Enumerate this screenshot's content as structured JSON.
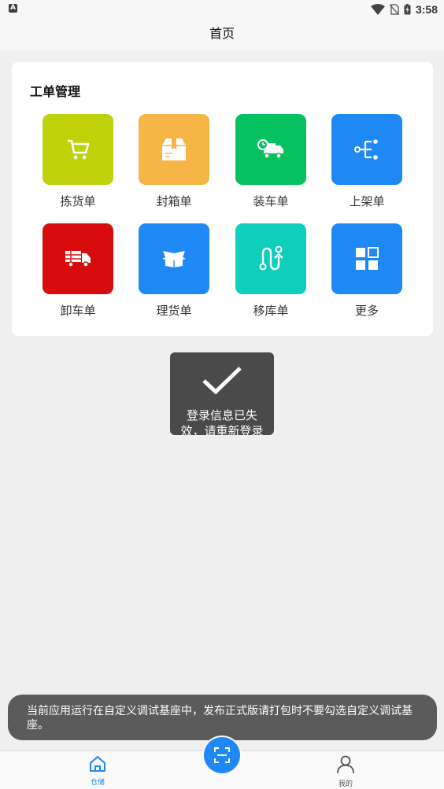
{
  "status_bar": {
    "time": "3:58"
  },
  "header": {
    "title": "首页"
  },
  "work_orders": {
    "title": "工单管理",
    "items": [
      {
        "label": "拣货单",
        "icon": "cart-icon",
        "color": "#bfd20a"
      },
      {
        "label": "封箱单",
        "icon": "box-icon",
        "color": "#f5b547"
      },
      {
        "label": "装车单",
        "icon": "truck-clock-icon",
        "color": "#06c160"
      },
      {
        "label": "上架单",
        "icon": "tree-icon",
        "color": "#1e88f5"
      },
      {
        "label": "卸车单",
        "icon": "unload-truck-icon",
        "color": "#d80c0c"
      },
      {
        "label": "理货单",
        "icon": "open-box-icon",
        "color": "#1e88f5"
      },
      {
        "label": "移库单",
        "icon": "route-icon",
        "color": "#0dcfbc"
      },
      {
        "label": "更多",
        "icon": "grid-icon",
        "color": "#1e88f5"
      }
    ]
  },
  "toast": {
    "message": "登录信息已失效，请重新登录"
  },
  "snackbar": {
    "message": "当前应用运行在自定义调试基座中，发布正式版请打包时不要勾选自定义调试基座。"
  },
  "tabbar": {
    "tabs": [
      {
        "label": "仓储",
        "icon": "home-icon",
        "active": true
      },
      {
        "label": "我的",
        "icon": "person-icon",
        "active": false
      }
    ]
  },
  "colors": {
    "accent": "#1e88f5"
  }
}
